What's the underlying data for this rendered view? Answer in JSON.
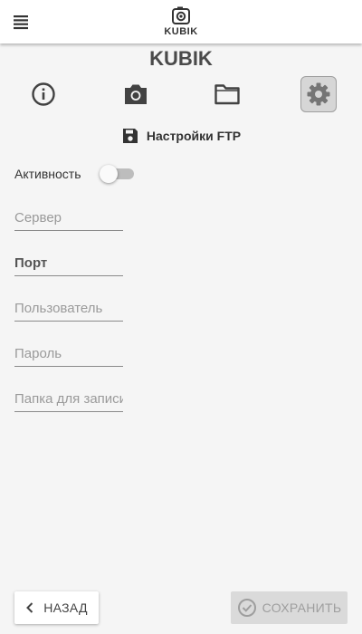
{
  "header": {
    "logo_text": "KUBIK"
  },
  "app_title": "KUBIK",
  "nav": {
    "items": [
      {
        "icon": "info-icon"
      },
      {
        "icon": "camera-icon"
      },
      {
        "icon": "folder-icon"
      },
      {
        "icon": "gear-icon",
        "active": true
      }
    ]
  },
  "section": {
    "title": "Настройки FTP",
    "icon": "save-icon"
  },
  "activity": {
    "label": "Активность",
    "enabled": false
  },
  "form": {
    "server_placeholder": "Сервер",
    "port_placeholder": "Порт",
    "user_placeholder": "Пользователь",
    "password_placeholder": "Пароль",
    "folder_placeholder": "Папка для записи"
  },
  "footer": {
    "back_label": "НАЗАД",
    "save_label": "СОХРАНИТЬ"
  },
  "colors": {
    "icon": "#424242",
    "active_tab_bg": "#d6d6d6",
    "save_disabled_bg": "#dadada",
    "save_disabled_text": "#9e9e9e"
  }
}
